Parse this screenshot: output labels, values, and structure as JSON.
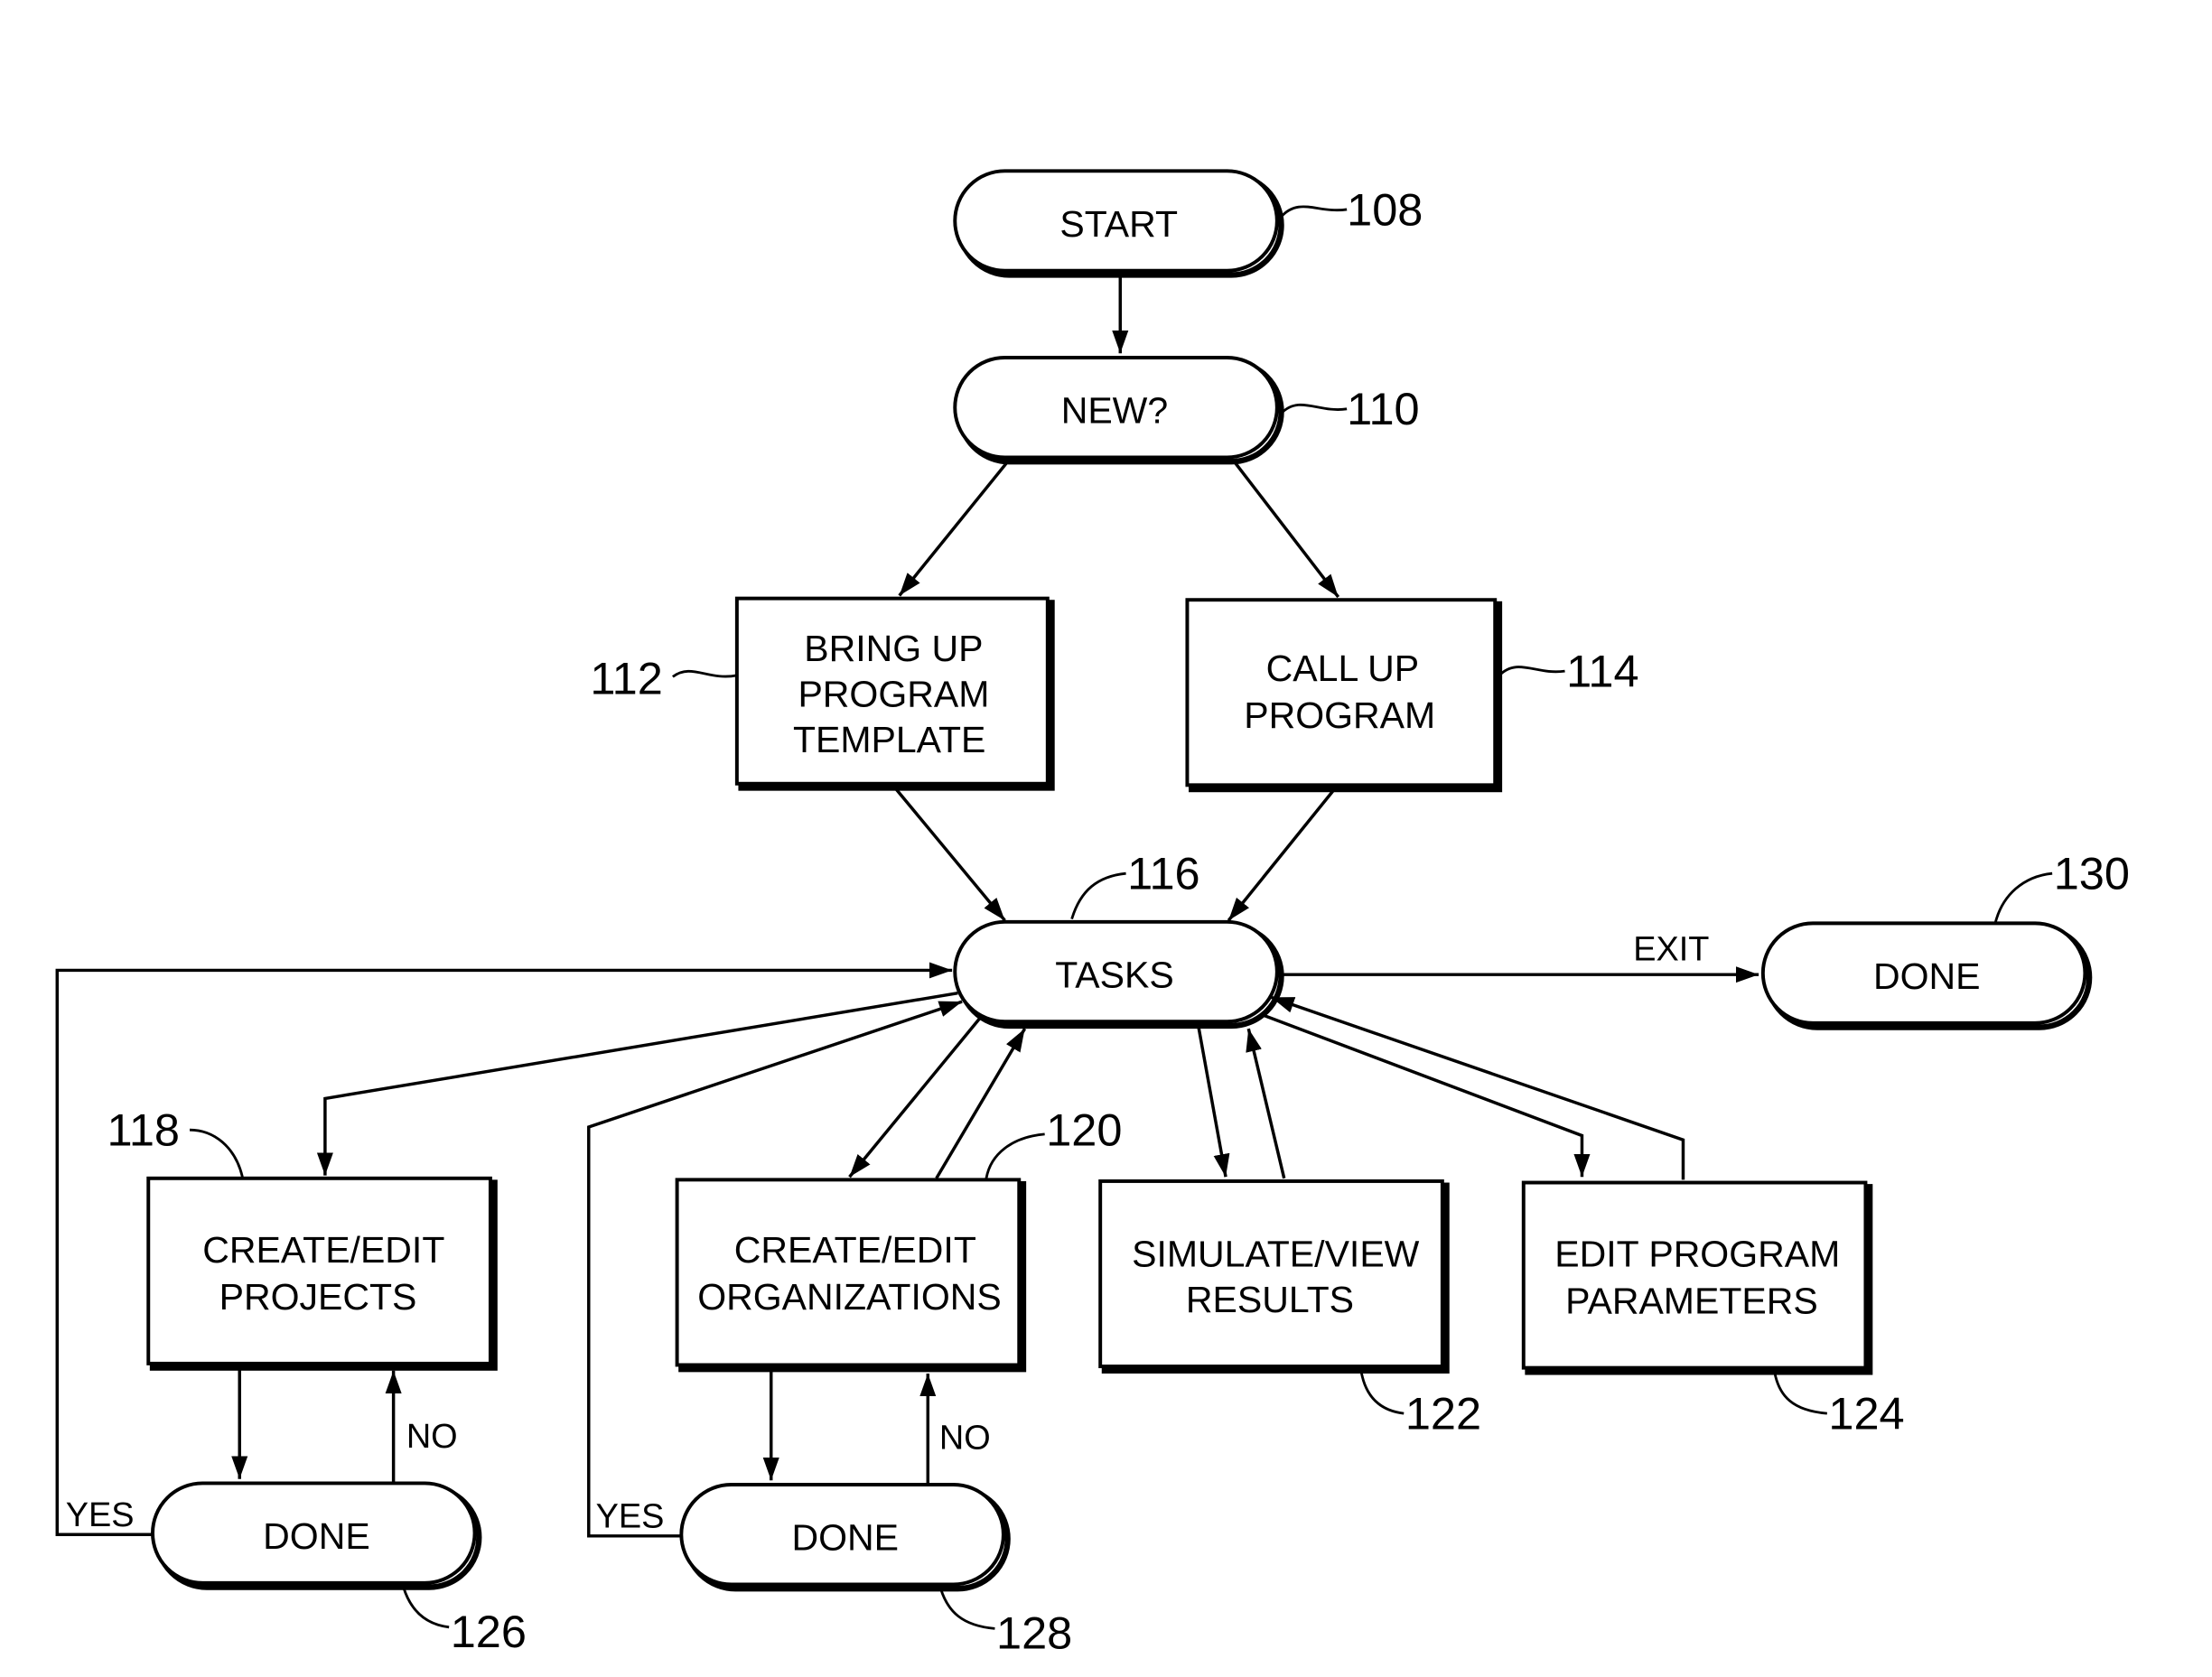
{
  "figure": {
    "nodes": [
      {
        "id": "start",
        "ref": "108",
        "shape": "terminal",
        "lines": [
          "START"
        ]
      },
      {
        "id": "new",
        "ref": "110",
        "shape": "terminal",
        "lines": [
          "NEW?"
        ]
      },
      {
        "id": "bring_up",
        "ref": "112",
        "shape": "process",
        "lines": [
          "BRING UP",
          "PROGRAM",
          "TEMPLATE"
        ]
      },
      {
        "id": "call_up",
        "ref": "114",
        "shape": "process",
        "lines": [
          "CALL UP",
          "PROGRAM"
        ]
      },
      {
        "id": "tasks",
        "ref": "116",
        "shape": "terminal",
        "lines": [
          "TASKS"
        ]
      },
      {
        "id": "projects",
        "ref": "118",
        "shape": "process",
        "lines": [
          "CREATE/EDIT",
          "PROJECTS"
        ]
      },
      {
        "id": "organizations",
        "ref": "120",
        "shape": "process",
        "lines": [
          "CREATE/EDIT",
          "ORGANIZATIONS"
        ]
      },
      {
        "id": "simulate",
        "ref": "122",
        "shape": "process",
        "lines": [
          "SIMULATE/VIEW",
          "RESULTS"
        ]
      },
      {
        "id": "edit_params",
        "ref": "124",
        "shape": "process",
        "lines": [
          "EDIT PROGRAM",
          "PARAMETERS"
        ]
      },
      {
        "id": "done_projects",
        "ref": "126",
        "shape": "terminal",
        "lines": [
          "DONE"
        ]
      },
      {
        "id": "done_orgs",
        "ref": "128",
        "shape": "terminal",
        "lines": [
          "DONE"
        ]
      },
      {
        "id": "done_exit",
        "ref": "130",
        "shape": "terminal",
        "lines": [
          "DONE"
        ]
      }
    ],
    "edges": [
      {
        "from": "start",
        "to": "new",
        "label": ""
      },
      {
        "from": "new",
        "to": "bring_up",
        "label": ""
      },
      {
        "from": "new",
        "to": "call_up",
        "label": ""
      },
      {
        "from": "bring_up",
        "to": "tasks",
        "label": ""
      },
      {
        "from": "call_up",
        "to": "tasks",
        "label": ""
      },
      {
        "from": "tasks",
        "to": "done_exit",
        "label": "EXIT"
      },
      {
        "from": "tasks",
        "to": "projects",
        "label": ""
      },
      {
        "from": "tasks",
        "to": "organizations",
        "label": ""
      },
      {
        "from": "organizations",
        "to": "tasks",
        "label": ""
      },
      {
        "from": "tasks",
        "to": "simulate",
        "label": ""
      },
      {
        "from": "simulate",
        "to": "tasks",
        "label": ""
      },
      {
        "from": "tasks",
        "to": "edit_params",
        "label": ""
      },
      {
        "from": "edit_params",
        "to": "tasks",
        "label": ""
      },
      {
        "from": "projects",
        "to": "done_projects",
        "label": ""
      },
      {
        "from": "done_projects",
        "to": "projects",
        "label": "NO"
      },
      {
        "from": "done_projects",
        "to": "tasks",
        "label": "YES"
      },
      {
        "from": "organizations",
        "to": "done_orgs",
        "label": ""
      },
      {
        "from": "done_orgs",
        "to": "organizations",
        "label": "NO"
      },
      {
        "from": "done_orgs",
        "to": "tasks",
        "label": "YES"
      }
    ],
    "edge_labels": {
      "exit": "EXIT",
      "yes_projects": "YES",
      "no_projects": "NO",
      "yes_orgs": "YES",
      "no_orgs": "NO"
    }
  }
}
